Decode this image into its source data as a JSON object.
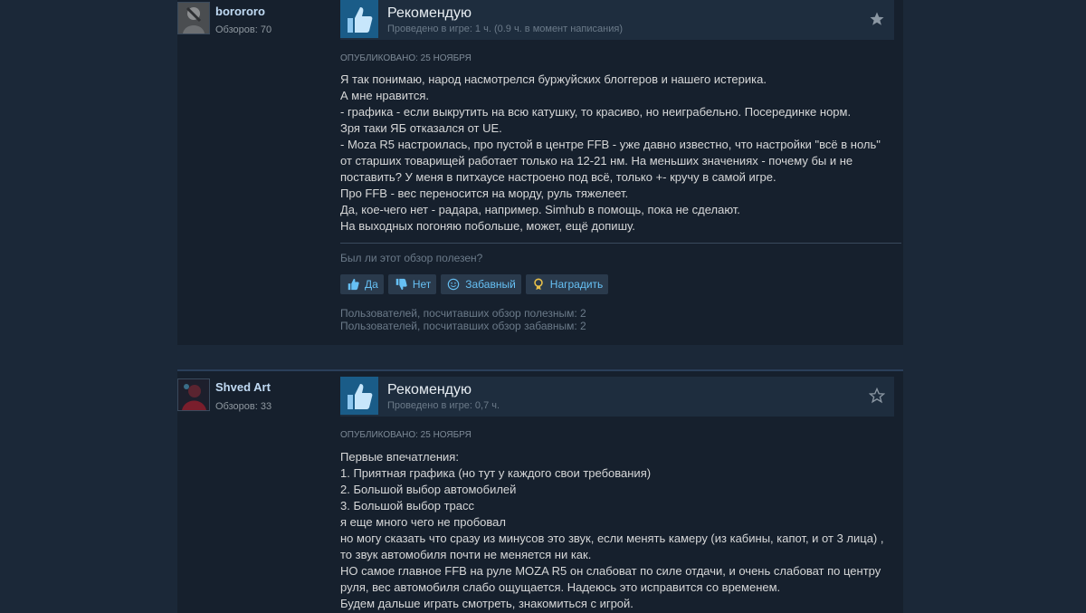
{
  "colors": {
    "background": "#1b2838",
    "card": "#16202d",
    "link": "#66c0f4",
    "thumb_bg": "#1a5c88"
  },
  "reviews": [
    {
      "author": "borororo",
      "reviews_count": "Обзоров: 70",
      "recommendation": "Рекомендую",
      "hours": "Проведено в игре: 1 ч. (0.9 ч. в момент написания)",
      "posted": "ОПУБЛИКОВАНО: 25 НОЯБРЯ",
      "starred": true,
      "lines": [
        "Я так понимаю, народ насмотрелся буржуйских блоггеров и нашего истерика.",
        "А мне нравится.",
        "- графика - если выкрутить на всю катушку, то красиво, но неиграбельно. Посерединке норм.",
        "Зря таки ЯБ отказался от UE.",
        "- Moza R5 настроилась, про пустой в центре FFB - уже давно известно, что настройки \"всё в ноль\" от старших товарищей работает только на 12-21 нм. На меньших значениях - почему бы и не поставить? У меня в питхаусе настроено под всё, только +- кручу в самой игре.",
        "Про FFB - вес переносится на морду, руль тяжелеет.",
        "Да, кое-чего нет - радара, например. Simhub в помощь, пока не сделают.",
        "На выходных погоняю побольше, может, ещё допишу."
      ],
      "helpful_question": "Был ли этот обзор полезен?",
      "buttons": {
        "yes": "Да",
        "no": "Нет",
        "funny": "Забавный",
        "award": "Наградить"
      },
      "stats_helpful": "Пользователей, посчитавших обзор полезным: 2",
      "stats_funny": "Пользователей, посчитавших обзор забавным: 2"
    },
    {
      "author": "Shved Art",
      "reviews_count": "Обзоров: 33",
      "recommendation": "Рекомендую",
      "hours": "Проведено в игре: 0,7 ч.",
      "posted": "ОПУБЛИКОВАНО: 25 НОЯБРЯ",
      "starred": false,
      "lines": [
        "Первые впечатления:",
        "1. Приятная графика (но тут у каждого свои требования)",
        "2. Большой выбор автомобилей",
        "3. Большой выбор трасс",
        "я еще много чего не пробовал",
        "но могу сказать что сразу из минусов это звук, если менять камеру (из кабины, капот, и от 3 лица) , то звук автомобиля почти не меняется ни как.",
        "НО самое главное FFB на руле MOZA R5 он слабоват по силе отдачи, и очень слабоват по центру руля, вес автомобиля слабо ощущается. Надеюсь это исправится со временем.",
        "Будем дальше играть смотреть, знакомиться с игрой."
      ]
    }
  ]
}
